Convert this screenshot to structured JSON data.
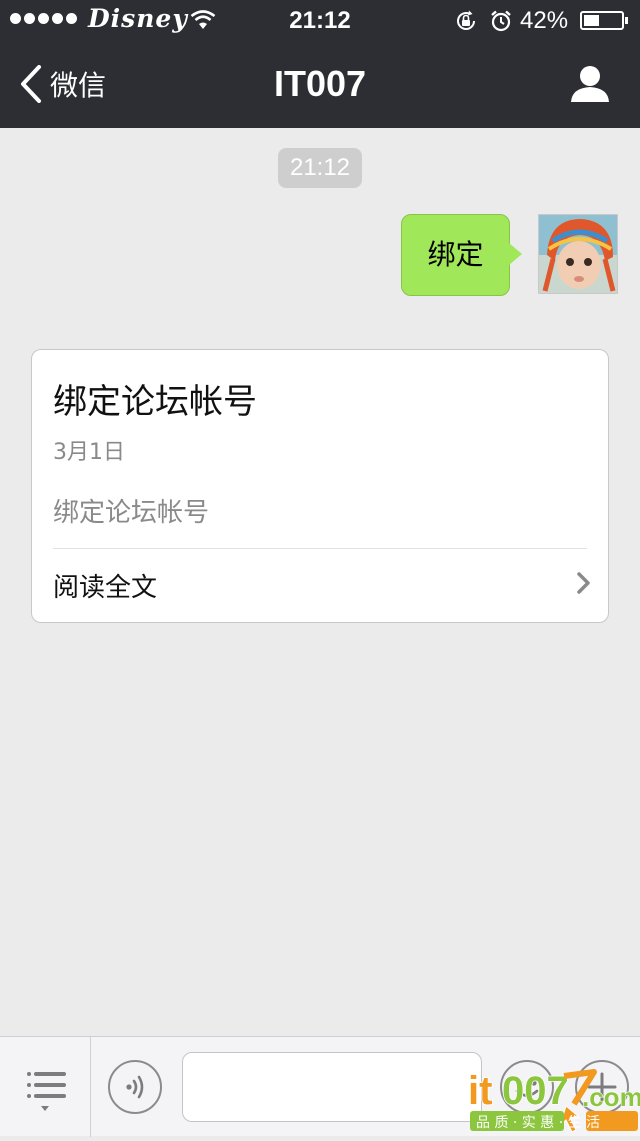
{
  "status_bar": {
    "signal_dots": 5,
    "carrier": "Disney",
    "wifi_icon": "wifi-icon",
    "time": "21:12",
    "rotation_lock_icon": "rotation-lock-icon",
    "alarm_icon": "alarm-icon",
    "battery_percent": "42%",
    "battery_level": 0.42
  },
  "nav": {
    "back_label": "微信",
    "title": "IT007",
    "back_icon": "chevron-left-icon",
    "profile_icon": "person-icon"
  },
  "chat": {
    "timestamp": "21:12",
    "messages": [
      {
        "from": "me",
        "text": "绑定"
      }
    ]
  },
  "article": {
    "title": "绑定论坛帐号",
    "date": "3月1日",
    "digest": "绑定论坛帐号",
    "read_more": "阅读全文",
    "chevron_icon": "chevron-right-icon"
  },
  "input_bar": {
    "menu_icon": "list-menu-icon",
    "voice_icon": "voice-icon",
    "text_value": "",
    "emoji_icon": "emoji-icon",
    "plus_icon": "plus-icon"
  },
  "watermark": {
    "logo_text": "it007.com",
    "tagline": "品 质 · 实 惠 · 生 活"
  },
  "colors": {
    "nav_bg": "#2d2e33",
    "chat_bg": "#ebebeb",
    "bubble_green": "#a0e75a",
    "watermark_orange": "#f29a1f",
    "watermark_green": "#8cc63f"
  }
}
